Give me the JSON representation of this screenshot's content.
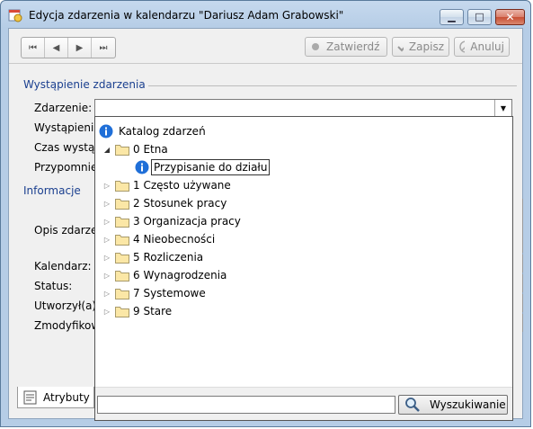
{
  "window": {
    "title": "Edycja zdarzenia w kalendarzu \"Dariusz Adam Grabowski\"",
    "caption_min": "▁",
    "caption_max": "□",
    "caption_close": "✕"
  },
  "toolbar": {
    "first": "⏮",
    "prev": "◀",
    "next": "▶",
    "last": "⏭",
    "confirm_label": "Zatwierdź",
    "save_label": "Zapisz",
    "cancel_label": "Anuluj"
  },
  "section_occurrence": {
    "header": "Wystąpienie zdarzenia",
    "event_label": "Zdarzenie:",
    "occurrence_label": "Wystąpienie",
    "time_label": "Czas wystąpi",
    "reminder_label": "Przypomnien"
  },
  "section_info": {
    "header": "Informacje",
    "description_label": "Opis zdarzen",
    "calendar_label": "Kalendarz:",
    "status_label": "Status:",
    "created_label": "Utworzył(a):",
    "modified_label": "Zmodyfikow"
  },
  "dropdown": {
    "root_label": "Katalog zdarzeń",
    "items": [
      {
        "label": "0 Etna",
        "expanded": true
      },
      {
        "label": "Przypisanie do działu",
        "child": true,
        "selected": true
      },
      {
        "label": "1 Często używane"
      },
      {
        "label": "2 Stosunek pracy"
      },
      {
        "label": "3 Organizacja pracy"
      },
      {
        "label": "4 Nieobecności"
      },
      {
        "label": "5 Rozliczenia"
      },
      {
        "label": "6 Wynagrodzenia"
      },
      {
        "label": "7 Systemowe"
      },
      {
        "label": "9 Stare"
      }
    ],
    "search_value": "",
    "search_button_label": "Wyszukiwanie"
  },
  "tabs": {
    "attributes_label": "Atrybuty"
  },
  "colors": {
    "frame": "#b6cde6",
    "section_header": "#1a3f8f",
    "folder": "#e8cf7a",
    "info_icon": "#1f6fd8"
  }
}
